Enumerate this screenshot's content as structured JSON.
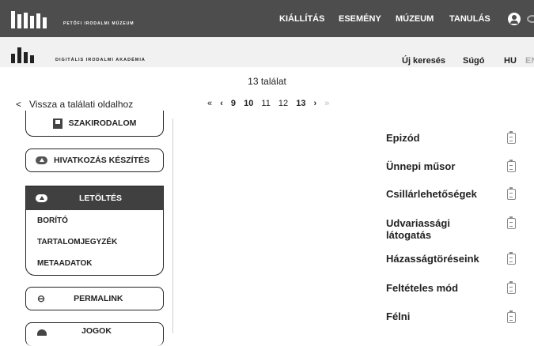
{
  "top_nav": {
    "logo_text": "PETŐFI IRODALMI MÚZEUM",
    "items": [
      "KIÁLLÍTÁS",
      "ESEMÉNY",
      "MÚZEUM",
      "TANULÁS"
    ]
  },
  "sub_nav": {
    "logo_text": "DIGITÁLIS IRODALMI AKADÉMIA",
    "new_search": "Új keresés",
    "help": "Súgó",
    "lang_hu": "HU",
    "lang_en": "EN"
  },
  "results": {
    "count_text": "13 találat",
    "back_link": "Vissza a találati oldalhoz"
  },
  "pager": {
    "first": "«",
    "prev": "‹",
    "pages": [
      "9",
      "10",
      "11",
      "12",
      "13"
    ],
    "current": "13",
    "next": "›",
    "last": "»"
  },
  "sidebar": {
    "szakirodalom": "SZAKIRODALOM",
    "hivatkozas": "HIVATKOZÁS KÉSZÍTÉS",
    "letoltes": "LETÖLTÉS",
    "download_items": [
      "BORÍTÓ",
      "TARTALOMJEGYZÉK",
      "METAADATOK"
    ],
    "permalink": "PERMALINK",
    "cut_label": "JOGOK"
  },
  "result_list": [
    "Epizód",
    "Ünnepi műsor",
    "Csillárlehetőségek",
    "Udvariassági látogatás",
    "Házasságtöréseink",
    "Feltételes mód",
    "Félni"
  ]
}
